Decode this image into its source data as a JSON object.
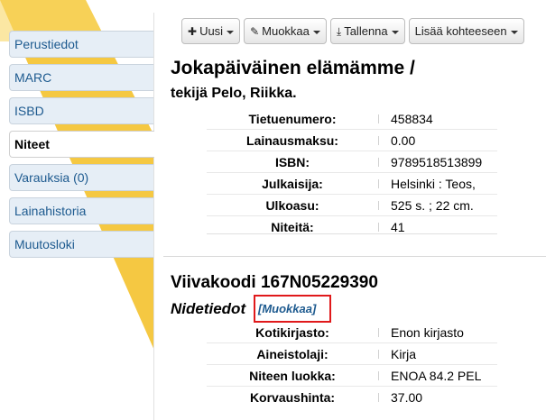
{
  "sidebar": {
    "items": [
      {
        "label": "Perustiedot",
        "active": false
      },
      {
        "label": "MARC",
        "active": false
      },
      {
        "label": "ISBD",
        "active": false
      },
      {
        "label": "Niteet",
        "active": true
      },
      {
        "label": "Varauksia (0)",
        "active": false
      },
      {
        "label": "Lainahistoria",
        "active": false
      },
      {
        "label": "Muutosloki",
        "active": false
      }
    ]
  },
  "toolbar": {
    "new_label": "Uusi",
    "edit_label": "Muokkaa",
    "save_label": "Tallenna",
    "add_to_label": "Lisää kohteeseen"
  },
  "record": {
    "title": "Jokapäiväinen elämämme /",
    "author_line": "tekijä Pelo, Riikka.",
    "fields": [
      {
        "label": "Tietuenumero:",
        "value": "458834"
      },
      {
        "label": "Lainausmaksu:",
        "value": "0.00"
      },
      {
        "label": "ISBN:",
        "value": "9789518513899"
      },
      {
        "label": "Julkaisija:",
        "value": "Helsinki : Teos,"
      },
      {
        "label": "Ulkoasu:",
        "value": "525 s. ; 22 cm."
      },
      {
        "label": "Niteitä:",
        "value": "41"
      }
    ]
  },
  "item": {
    "barcode_heading": "Viivakoodi 167N05229390",
    "section_heading": "Nidetiedot",
    "edit_link": "[Muokkaa]",
    "fields": [
      {
        "label": "Kotikirjasto:",
        "value": "Enon kirjasto"
      },
      {
        "label": "Aineistolaji:",
        "value": "Kirja"
      },
      {
        "label": "Niteen luokka:",
        "value": "ENOA 84.2 PEL"
      },
      {
        "label": "Korvaushinta:",
        "value": "37.00"
      }
    ]
  },
  "colors": {
    "accent_yellow": "#f5c842",
    "link_blue": "#1d5a8f",
    "highlight_red": "#e0191b"
  }
}
